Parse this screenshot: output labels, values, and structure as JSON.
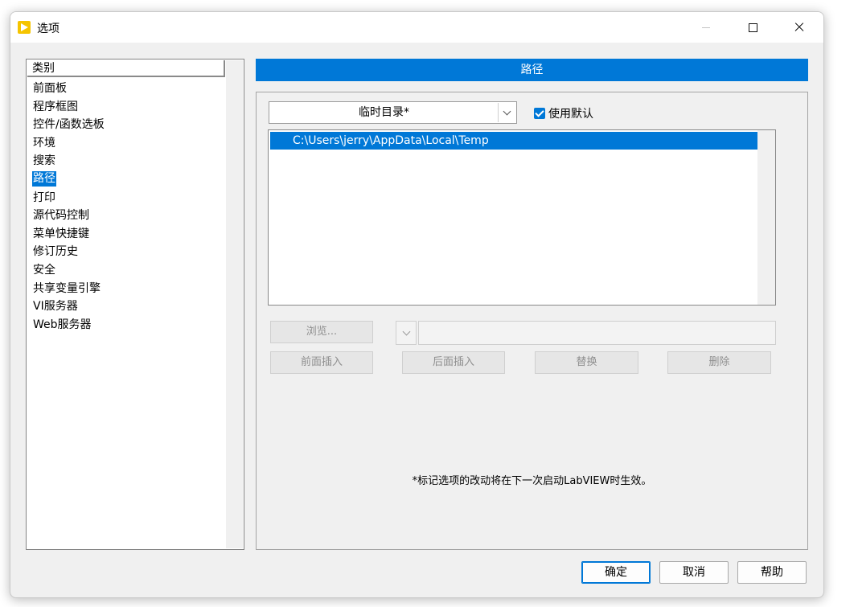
{
  "window": {
    "title": "选项"
  },
  "categories": {
    "header": "类别",
    "items": [
      "前面板",
      "程序框图",
      "控件/函数选板",
      "环境",
      "搜索",
      "路径",
      "打印",
      "源代码控制",
      "菜单快捷键",
      "修订历史",
      "安全",
      "共享变量引擎",
      "VI服务器",
      "Web服务器"
    ],
    "selected": "路径"
  },
  "panel": {
    "header": "路径",
    "directory_select": "临时目录*",
    "use_default_label": "使用默认",
    "use_default_checked": true,
    "paths": [
      "C:\\Users\\jerry\\AppData\\Local\\Temp"
    ],
    "path_field_value": "",
    "buttons": {
      "browse": "浏览...",
      "insert_before": "前面插入",
      "insert_after": "后面插入",
      "replace": "替换",
      "delete": "删除"
    },
    "note": "*标记选项的改动将在下一次启动LabVIEW时生效。"
  },
  "footer": {
    "ok": "确定",
    "cancel": "取消",
    "help": "帮助"
  },
  "colors": {
    "accent": "#0078d7",
    "dialog_bg": "#f0f0f0"
  },
  "icons": {
    "app": "labview-icon",
    "minimize": "minimize-icon",
    "maximize": "maximize-icon",
    "close": "close-icon"
  }
}
